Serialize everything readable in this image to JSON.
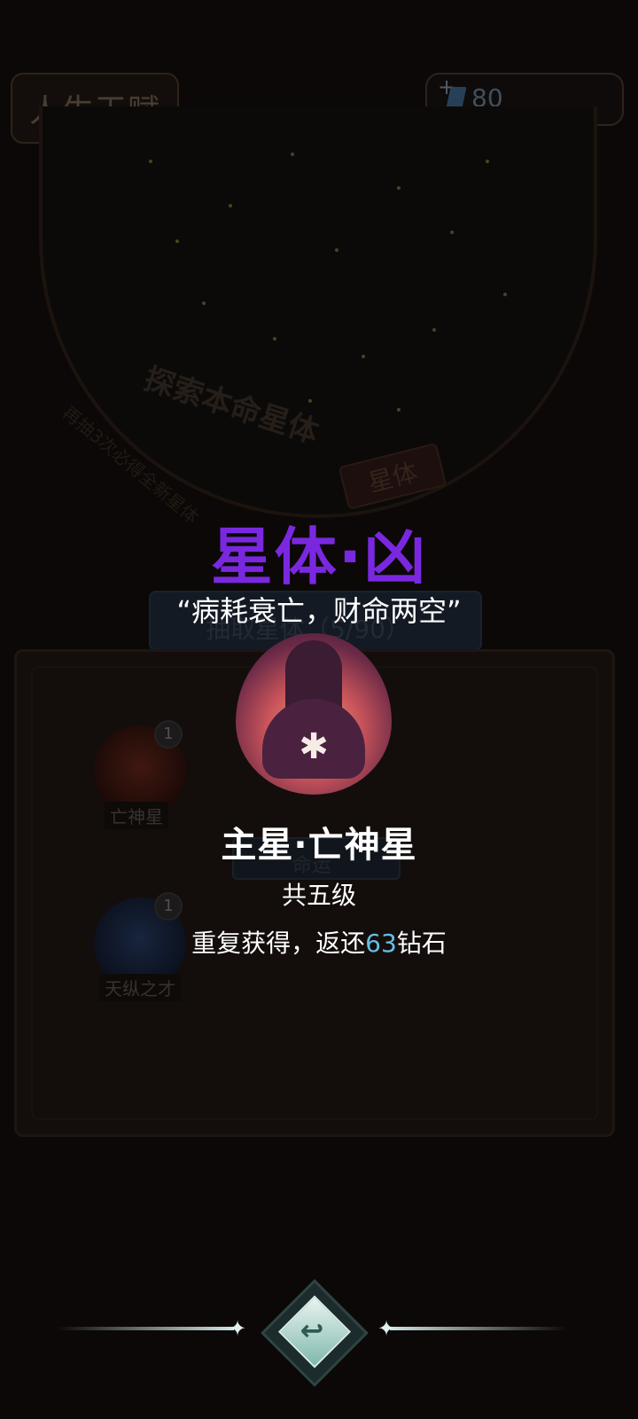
{
  "header": {
    "title": "人生天赋",
    "gems": {
      "value": "80",
      "icon": "diamond-icon",
      "add_icon": "plus-icon"
    }
  },
  "starmap": {
    "title": "探索本命星体",
    "subtitle": "再抽3次必得全新星体",
    "tab_label": "星体"
  },
  "background_panel": {
    "draw_button_label": "抽取星体（5/90）",
    "fate_button_label": "命运",
    "items": [
      {
        "label": "亡神星",
        "count": "1",
        "icon": "death-star-icon"
      },
      {
        "label": "天纵之才",
        "count": "1",
        "icon": "genius-orb-icon"
      }
    ]
  },
  "reward_popup": {
    "rarity": "星体·凶",
    "quote": "“病耗衰亡，财命两空”",
    "portrait_icon": "hooded-figure-icon",
    "name": "主星·亡神星",
    "levels": "共五级",
    "refund_prefix": "重复获得，返还",
    "refund_amount": "63",
    "refund_suffix": "钻石"
  },
  "footer": {
    "back_icon": "return-arrow-icon"
  },
  "colors": {
    "rarity": "#7a28e0",
    "refund_amount": "#66bfe6",
    "background": "#0b0807"
  }
}
